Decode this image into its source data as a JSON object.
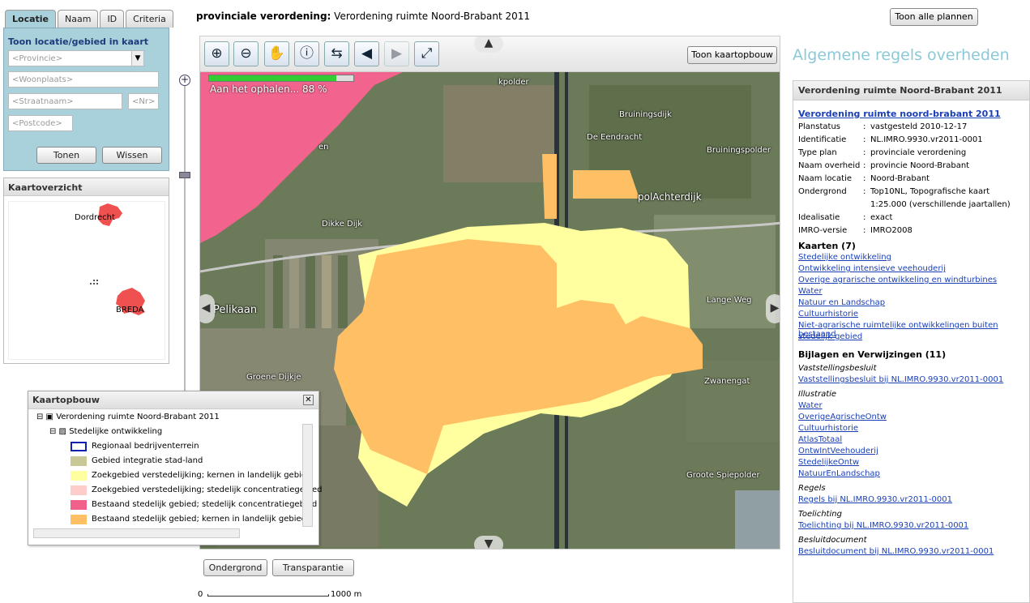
{
  "tabs": [
    "Locatie",
    "Naam",
    "ID",
    "Criteria"
  ],
  "search": {
    "title": "Toon locatie/gebied in kaart",
    "provincie": "<Provincie>",
    "woonplaats": "<Woonplaats>",
    "straat": "<Straatnaam>",
    "nr": "<Nr>",
    "postcode": "<Postcode>",
    "show": "Tonen",
    "clear": "Wissen"
  },
  "overview": {
    "title": "Kaartoverzicht",
    "labels": [
      "Dordrecht",
      "BREDA"
    ]
  },
  "map": {
    "header_label": "provinciale verordening:",
    "header_value": "Verordening ruimte Noord-Brabant 2011",
    "show_all": "Toon alle plannen",
    "show_layers": "Toon kaartopbouw",
    "loading": "Aan het ophalen... 88 %",
    "loading_pct": 88,
    "labels": [
      "Pelikaan",
      "Dikke Dijk",
      "Groene Dijkje",
      "Zwanengat",
      "Lange Weg",
      "Groote Spiepolder",
      "Bruiningsdijk",
      "Bruiningspolder",
      "De Eendracht",
      "polAchterdijk",
      "kpolder",
      "en"
    ],
    "bottom_buttons": [
      "Ondergrond",
      "Transparantie"
    ],
    "scale_zero": "0",
    "scale_label": "1000 m"
  },
  "legend": {
    "title": "Kaartopbouw",
    "plan": "Verordening ruimte Noord-Brabant 2011",
    "group": "Stedelijke ontwikkeling",
    "items": [
      {
        "label": "Regionaal bedrijventerrein",
        "color": "#ffffff",
        "border": "#1020b0"
      },
      {
        "label": "Gebied integratie stad-land",
        "color": "#c8c896"
      },
      {
        "label": "Zoekgebied verstedelijking; kernen in landelijk gebied",
        "color": "#ffffa0"
      },
      {
        "label": "Zoekgebied verstedelijking; stedelijk concentratiegebied",
        "color": "#ffcccc"
      },
      {
        "label": "Bestaand stedelijk gebied; stedelijk concentratiegebied",
        "color": "#f0608a"
      },
      {
        "label": "Bestaand stedelijk gebied; kernen in landelijk gebied",
        "color": "#ffbf64"
      }
    ]
  },
  "info": {
    "section_title": "Algemene regels overheden",
    "box_title": "Verordening ruimte Noord-Brabant 2011",
    "plan_link": "Verordening ruimte noord-brabant 2011",
    "props": [
      {
        "k": "Planstatus",
        "v": "vastgesteld 2010-12-17"
      },
      {
        "k": "Identificatie",
        "v": "NL.IMRO.9930.vr2011-0001"
      },
      {
        "k": "Type plan",
        "v": "provinciale verordening"
      },
      {
        "k": "Naam overheid",
        "v": "provincie Noord-Brabant"
      },
      {
        "k": "Naam locatie",
        "v": "Noord-Brabant"
      },
      {
        "k": "Ondergrond",
        "v": "Top10NL, Topografische kaart"
      },
      {
        "k": "",
        "v": "1:25.000 (verschillende jaartallen)"
      },
      {
        "k": "Idealisatie",
        "v": "exact"
      },
      {
        "k": "IMRO-versie",
        "v": "IMRO2008"
      }
    ],
    "maps_title": "Kaarten (7)",
    "maps": [
      "Stedelijke ontwikkeling",
      "Ontwikkeling intensieve veehouderij",
      "Overige agrarische ontwikkeling en windturbines",
      "Water",
      "Natuur en Landschap",
      "Cultuurhistorie",
      "Niet-agrarische ruimtelijke ontwikkelingen buiten bestaand",
      "stedelijk gebied"
    ],
    "att_title": "Bijlagen en Verwijzingen (11)",
    "groups": [
      {
        "name": "Vaststellingsbesluit",
        "links": [
          "Vaststellingsbesluit bij NL.IMRO.9930.vr2011-0001"
        ]
      },
      {
        "name": "Illustratie",
        "links": [
          "Water",
          "OverigeAgrischeOntw",
          "Cultuurhistorie",
          "AtlasTotaal",
          "OntwIntVeehouderij",
          "StedelijkeOntw",
          "NatuurEnLandschap"
        ]
      },
      {
        "name": "Regels",
        "links": [
          "Regels bij NL.IMRO.9930.vr2011-0001"
        ]
      },
      {
        "name": "Toelichting",
        "links": [
          "Toelichting bij NL.IMRO.9930.vr2011-0001"
        ]
      },
      {
        "name": "Besluitdocument",
        "links": [
          "Besluitdocument bij NL.IMRO.9930.vr2011-0001"
        ]
      }
    ]
  }
}
